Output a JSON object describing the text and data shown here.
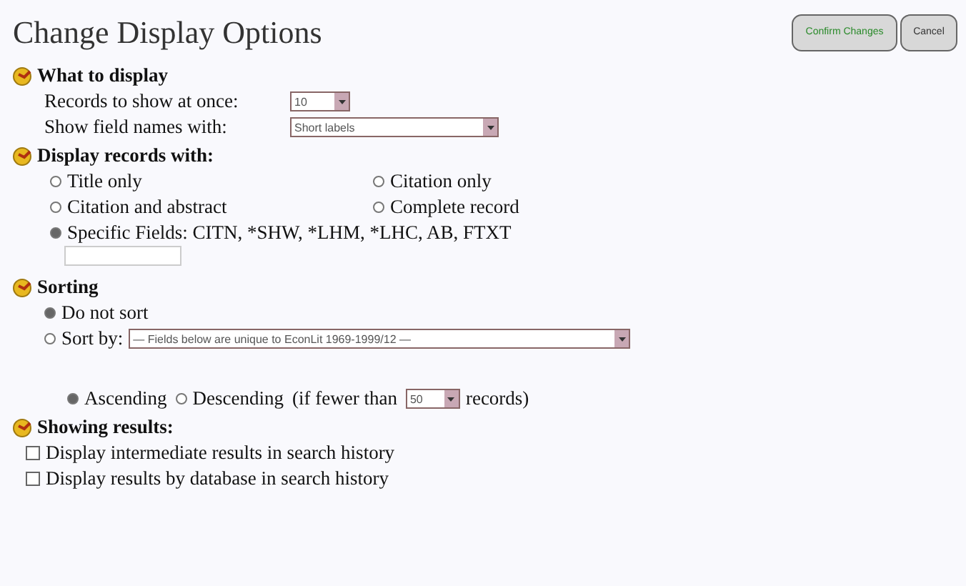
{
  "title": "Change Display Options",
  "buttons": [
    {
      "label": "Confirm Changes",
      "kind": "confirm"
    },
    {
      "label": "Cancel",
      "kind": "cancel"
    }
  ],
  "what_to_display": {
    "heading": "What to display",
    "selects": [
      {
        "label": "Records to show at once:",
        "value": "10"
      },
      {
        "label": "Show field names with:",
        "value": "Short labels"
      }
    ]
  },
  "display_records": {
    "heading": "Display records with:",
    "options": [
      {
        "label": "Title only",
        "selected": false
      },
      {
        "label": "Citation only",
        "selected": false
      },
      {
        "label": "Citation and abstract",
        "selected": false
      },
      {
        "label": "Complete record",
        "selected": false
      },
      {
        "label": "Specific Fields: CITN, *SHW, *LHM, *LHC, AB, FTXT",
        "selected": true
      }
    ]
  },
  "sorting": {
    "heading": "Sorting",
    "options": [
      {
        "label": "Do not sort",
        "selected": true
      },
      {
        "label": "Sort by:",
        "selected": false
      }
    ],
    "sort_field": "— Fields below are unique to EconLit 1969-1999/12 —",
    "orders": [
      {
        "label": "Ascending",
        "selected": true
      },
      {
        "label": "Descending",
        "selected": false
      }
    ],
    "limit_prefix": "(if fewer than",
    "limit_value": "50",
    "limit_suffix": "records)"
  },
  "showing_results": {
    "heading": "Showing results:",
    "options": [
      {
        "label": "Display intermediate results in search history",
        "checked": false
      },
      {
        "label": "Display results by database in search history",
        "checked": false
      }
    ]
  }
}
